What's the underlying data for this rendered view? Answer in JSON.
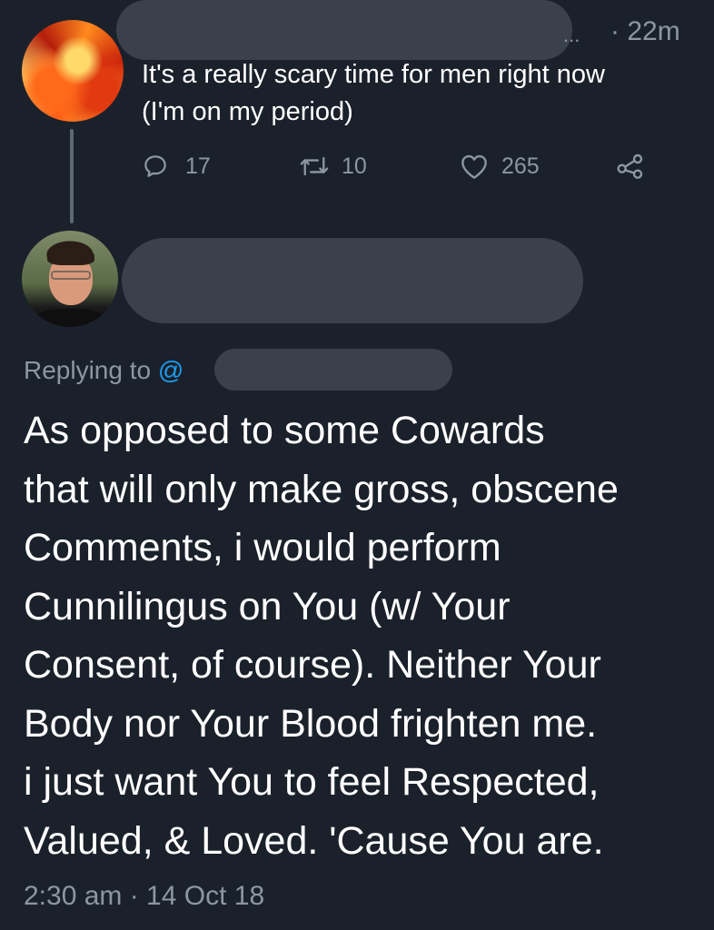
{
  "colors": {
    "background": "#1b212b",
    "text_primary": "#ffffff",
    "text_secondary": "#8c97a3",
    "accent": "#1d9bf0",
    "redaction": "#3a414b"
  },
  "tweet1": {
    "ellipsis": "...",
    "time": "· 22m",
    "lines": [
      "It's a really scary time for men right now",
      "(I'm on my period)"
    ],
    "actions": {
      "reply": {
        "icon": "reply-icon",
        "count": "17"
      },
      "retweet": {
        "icon": "retweet-icon",
        "count": "10"
      },
      "like": {
        "icon": "heart-icon",
        "count": "265"
      },
      "share": {
        "icon": "share-icon"
      }
    }
  },
  "tweet2": {
    "replying_label": "Replying to",
    "replying_at": "@",
    "lines": [
      "As opposed to some Cowards",
      "that will only make gross, obscene",
      "Comments, i would perform",
      "Cunnilingus on You (w/ Your",
      "Consent, of course).  Neither Your",
      "Body nor Your Blood frighten me.",
      "i just want You to feel Respected,",
      "Valued, & Loved.  'Cause You are."
    ],
    "timestamp": "2:30 am · 14 Oct 18"
  }
}
